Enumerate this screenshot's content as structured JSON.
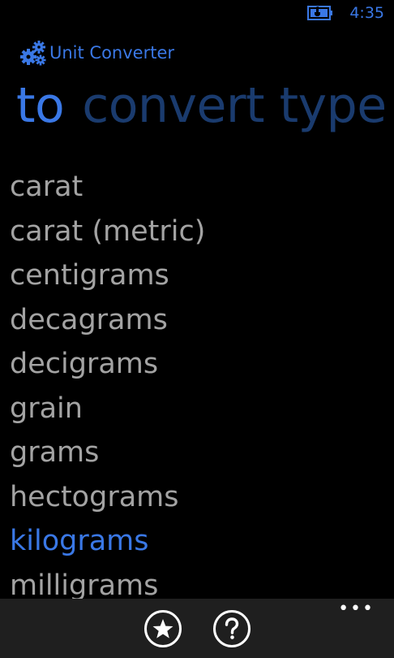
{
  "status_bar": {
    "time": "4:35",
    "battery_icon": "battery-charging-icon",
    "accent_color": "#3a78e6"
  },
  "app": {
    "title": "Unit Converter",
    "logo_icon": "gears-icon"
  },
  "pivot": {
    "tabs": [
      {
        "label": "to",
        "active": true
      },
      {
        "label": "convert type",
        "active": false
      }
    ]
  },
  "units": {
    "items": [
      {
        "label": "carat",
        "selected": false
      },
      {
        "label": "carat (metric)",
        "selected": false
      },
      {
        "label": "centigrams",
        "selected": false
      },
      {
        "label": "decagrams",
        "selected": false
      },
      {
        "label": "decigrams",
        "selected": false
      },
      {
        "label": "grain",
        "selected": false
      },
      {
        "label": "grams",
        "selected": false
      },
      {
        "label": "hectograms",
        "selected": false
      },
      {
        "label": "kilograms",
        "selected": true
      },
      {
        "label": "milligrams",
        "selected": false
      }
    ]
  },
  "app_bar": {
    "buttons": [
      {
        "icon": "star-icon"
      },
      {
        "icon": "help-icon"
      }
    ],
    "more_label": "•••"
  },
  "colors": {
    "accent": "#3a78e6",
    "inactive_pivot": "#1a3b6e",
    "list_text": "#a3a3a3",
    "app_bar_bg": "#1f1f1f",
    "background": "#000000"
  }
}
